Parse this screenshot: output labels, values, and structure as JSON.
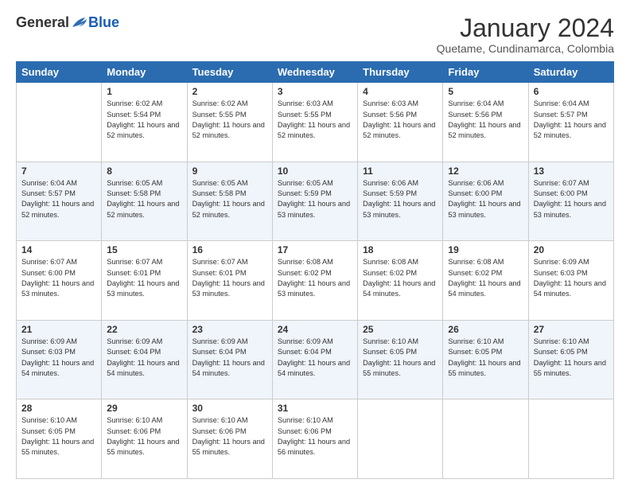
{
  "header": {
    "logo": {
      "general": "General",
      "blue": "Blue"
    },
    "title": "January 2024",
    "location": "Quetame, Cundinamarca, Colombia"
  },
  "weekdays": [
    "Sunday",
    "Monday",
    "Tuesday",
    "Wednesday",
    "Thursday",
    "Friday",
    "Saturday"
  ],
  "weeks": [
    [
      {
        "day": "",
        "sunrise": "",
        "sunset": "",
        "daylight": ""
      },
      {
        "day": "1",
        "sunrise": "Sunrise: 6:02 AM",
        "sunset": "Sunset: 5:54 PM",
        "daylight": "Daylight: 11 hours and 52 minutes."
      },
      {
        "day": "2",
        "sunrise": "Sunrise: 6:02 AM",
        "sunset": "Sunset: 5:55 PM",
        "daylight": "Daylight: 11 hours and 52 minutes."
      },
      {
        "day": "3",
        "sunrise": "Sunrise: 6:03 AM",
        "sunset": "Sunset: 5:55 PM",
        "daylight": "Daylight: 11 hours and 52 minutes."
      },
      {
        "day": "4",
        "sunrise": "Sunrise: 6:03 AM",
        "sunset": "Sunset: 5:56 PM",
        "daylight": "Daylight: 11 hours and 52 minutes."
      },
      {
        "day": "5",
        "sunrise": "Sunrise: 6:04 AM",
        "sunset": "Sunset: 5:56 PM",
        "daylight": "Daylight: 11 hours and 52 minutes."
      },
      {
        "day": "6",
        "sunrise": "Sunrise: 6:04 AM",
        "sunset": "Sunset: 5:57 PM",
        "daylight": "Daylight: 11 hours and 52 minutes."
      }
    ],
    [
      {
        "day": "7",
        "sunrise": "Sunrise: 6:04 AM",
        "sunset": "Sunset: 5:57 PM",
        "daylight": "Daylight: 11 hours and 52 minutes."
      },
      {
        "day": "8",
        "sunrise": "Sunrise: 6:05 AM",
        "sunset": "Sunset: 5:58 PM",
        "daylight": "Daylight: 11 hours and 52 minutes."
      },
      {
        "day": "9",
        "sunrise": "Sunrise: 6:05 AM",
        "sunset": "Sunset: 5:58 PM",
        "daylight": "Daylight: 11 hours and 52 minutes."
      },
      {
        "day": "10",
        "sunrise": "Sunrise: 6:05 AM",
        "sunset": "Sunset: 5:59 PM",
        "daylight": "Daylight: 11 hours and 53 minutes."
      },
      {
        "day": "11",
        "sunrise": "Sunrise: 6:06 AM",
        "sunset": "Sunset: 5:59 PM",
        "daylight": "Daylight: 11 hours and 53 minutes."
      },
      {
        "day": "12",
        "sunrise": "Sunrise: 6:06 AM",
        "sunset": "Sunset: 6:00 PM",
        "daylight": "Daylight: 11 hours and 53 minutes."
      },
      {
        "day": "13",
        "sunrise": "Sunrise: 6:07 AM",
        "sunset": "Sunset: 6:00 PM",
        "daylight": "Daylight: 11 hours and 53 minutes."
      }
    ],
    [
      {
        "day": "14",
        "sunrise": "Sunrise: 6:07 AM",
        "sunset": "Sunset: 6:00 PM",
        "daylight": "Daylight: 11 hours and 53 minutes."
      },
      {
        "day": "15",
        "sunrise": "Sunrise: 6:07 AM",
        "sunset": "Sunset: 6:01 PM",
        "daylight": "Daylight: 11 hours and 53 minutes."
      },
      {
        "day": "16",
        "sunrise": "Sunrise: 6:07 AM",
        "sunset": "Sunset: 6:01 PM",
        "daylight": "Daylight: 11 hours and 53 minutes."
      },
      {
        "day": "17",
        "sunrise": "Sunrise: 6:08 AM",
        "sunset": "Sunset: 6:02 PM",
        "daylight": "Daylight: 11 hours and 53 minutes."
      },
      {
        "day": "18",
        "sunrise": "Sunrise: 6:08 AM",
        "sunset": "Sunset: 6:02 PM",
        "daylight": "Daylight: 11 hours and 54 minutes."
      },
      {
        "day": "19",
        "sunrise": "Sunrise: 6:08 AM",
        "sunset": "Sunset: 6:02 PM",
        "daylight": "Daylight: 11 hours and 54 minutes."
      },
      {
        "day": "20",
        "sunrise": "Sunrise: 6:09 AM",
        "sunset": "Sunset: 6:03 PM",
        "daylight": "Daylight: 11 hours and 54 minutes."
      }
    ],
    [
      {
        "day": "21",
        "sunrise": "Sunrise: 6:09 AM",
        "sunset": "Sunset: 6:03 PM",
        "daylight": "Daylight: 11 hours and 54 minutes."
      },
      {
        "day": "22",
        "sunrise": "Sunrise: 6:09 AM",
        "sunset": "Sunset: 6:04 PM",
        "daylight": "Daylight: 11 hours and 54 minutes."
      },
      {
        "day": "23",
        "sunrise": "Sunrise: 6:09 AM",
        "sunset": "Sunset: 6:04 PM",
        "daylight": "Daylight: 11 hours and 54 minutes."
      },
      {
        "day": "24",
        "sunrise": "Sunrise: 6:09 AM",
        "sunset": "Sunset: 6:04 PM",
        "daylight": "Daylight: 11 hours and 54 minutes."
      },
      {
        "day": "25",
        "sunrise": "Sunrise: 6:10 AM",
        "sunset": "Sunset: 6:05 PM",
        "daylight": "Daylight: 11 hours and 55 minutes."
      },
      {
        "day": "26",
        "sunrise": "Sunrise: 6:10 AM",
        "sunset": "Sunset: 6:05 PM",
        "daylight": "Daylight: 11 hours and 55 minutes."
      },
      {
        "day": "27",
        "sunrise": "Sunrise: 6:10 AM",
        "sunset": "Sunset: 6:05 PM",
        "daylight": "Daylight: 11 hours and 55 minutes."
      }
    ],
    [
      {
        "day": "28",
        "sunrise": "Sunrise: 6:10 AM",
        "sunset": "Sunset: 6:05 PM",
        "daylight": "Daylight: 11 hours and 55 minutes."
      },
      {
        "day": "29",
        "sunrise": "Sunrise: 6:10 AM",
        "sunset": "Sunset: 6:06 PM",
        "daylight": "Daylight: 11 hours and 55 minutes."
      },
      {
        "day": "30",
        "sunrise": "Sunrise: 6:10 AM",
        "sunset": "Sunset: 6:06 PM",
        "daylight": "Daylight: 11 hours and 55 minutes."
      },
      {
        "day": "31",
        "sunrise": "Sunrise: 6:10 AM",
        "sunset": "Sunset: 6:06 PM",
        "daylight": "Daylight: 11 hours and 56 minutes."
      },
      {
        "day": "",
        "sunrise": "",
        "sunset": "",
        "daylight": ""
      },
      {
        "day": "",
        "sunrise": "",
        "sunset": "",
        "daylight": ""
      },
      {
        "day": "",
        "sunrise": "",
        "sunset": "",
        "daylight": ""
      }
    ]
  ]
}
